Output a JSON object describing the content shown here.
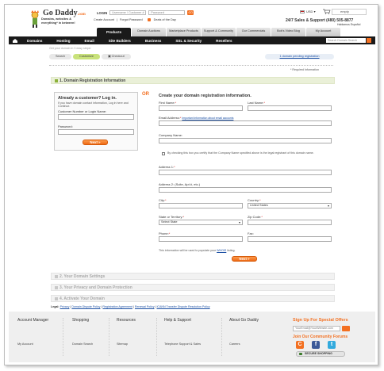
{
  "header": {
    "logo_name": "Go Daddy",
    "logo_suffix": ".com",
    "logo_tagline_1": "Domains, websites &",
    "logo_tagline_2": "everything* in between!",
    "login_label": "LOGIN",
    "username_placeholder": "Username / Customer #",
    "password_placeholder": "Password",
    "go_label": "GO",
    "create_account": "Create Account",
    "forgot_password": "Forgot Password",
    "deals_of_day": "Deals of the Day",
    "currency": "USD",
    "cart_status": "empty",
    "support_text": "24/7 Sales & Support (480) 505-8877",
    "hablamos": "Hablamos Español"
  },
  "tabs": [
    {
      "label": "Products",
      "active": true
    },
    {
      "label": "Domain Auctions"
    },
    {
      "label": "Marketplace Products"
    },
    {
      "label": "Support & Community"
    },
    {
      "label": "Our Commercials"
    },
    {
      "label": "Bob's Video Blog"
    },
    {
      "label": "My Account"
    }
  ],
  "nav": {
    "items": [
      "Domains",
      "Hosting",
      "Email",
      "Site Builders",
      "Business",
      "SSL & Security",
      "Resellers"
    ],
    "search_placeholder": "Search Domain Search"
  },
  "tagline": "Get your domain in 3 easy steps!",
  "steps": [
    {
      "label": "Search"
    },
    {
      "label": "Customize",
      "current": true
    },
    {
      "label": "Checkout"
    }
  ],
  "pending_link": "1 domain pending registration",
  "required_note": "* Required Information",
  "section1_title": "1. Domain Registration Information",
  "login_box": {
    "title": "Already a customer? Log in.",
    "desc": "If you have domain contact information, Log in here and Continue.",
    "customer_label": "Customer Number or Login Name:",
    "password_label": "Password:",
    "next_label": "Next »"
  },
  "or_label": "OR",
  "create_form": {
    "title": "Create your domain registration information.",
    "first_name": "First Name:",
    "last_name": "Last Name:",
    "email": "Email Address:",
    "email_hint": "Important information about email accounts",
    "company": "Company Name:",
    "checkbox_text": "By checking this box you certify that the Company Name specified above is the legal registrant of this domain name.",
    "address1": "Address 1:",
    "address2": "Address 2: (Suite, Apt #, etc.)",
    "city": "City:",
    "country": "Country:",
    "country_value": "United States",
    "state": "State or Territory:",
    "state_value": "Select State",
    "zip": "Zip Code:",
    "phone": "Phone:",
    "fax": "Fax:",
    "info_text_1": "This information will be used to populate your",
    "info_link": "WHOIS",
    "info_text_2": "listing.",
    "next_label": "Next »"
  },
  "collapsed_sections": [
    "2. Your Domain Settings",
    "3. Your Privacy and Domain Protection",
    "4. Activate Your Domain"
  ],
  "legal": {
    "label": "Legal:",
    "links": [
      "Privacy",
      "Domain Dispute Policy",
      "Registration Agreement",
      "Renewal Policy",
      "ICANN Transfer Dispute Resolution Policy"
    ]
  },
  "footer": {
    "columns": [
      "Account Manager",
      "Shopping",
      "Resources",
      "Help & Support",
      "About Go Daddy"
    ],
    "links": [
      "My Account",
      "Domain Search",
      "Sitemap",
      "Telephone Support & Sales",
      "Careers"
    ],
    "signup_title": "Sign Up For Special Offers",
    "email_placeholder": "YourEmail@YourWebsite.com",
    "community_title": "Join Our Community Forums",
    "secure_label": "SECURE SHOPPING"
  },
  "colors": {
    "accent": "#f37021",
    "nav_bg": "#1a1a1a",
    "link": "#1b4fa3",
    "section_green": "#eaf0d8"
  }
}
